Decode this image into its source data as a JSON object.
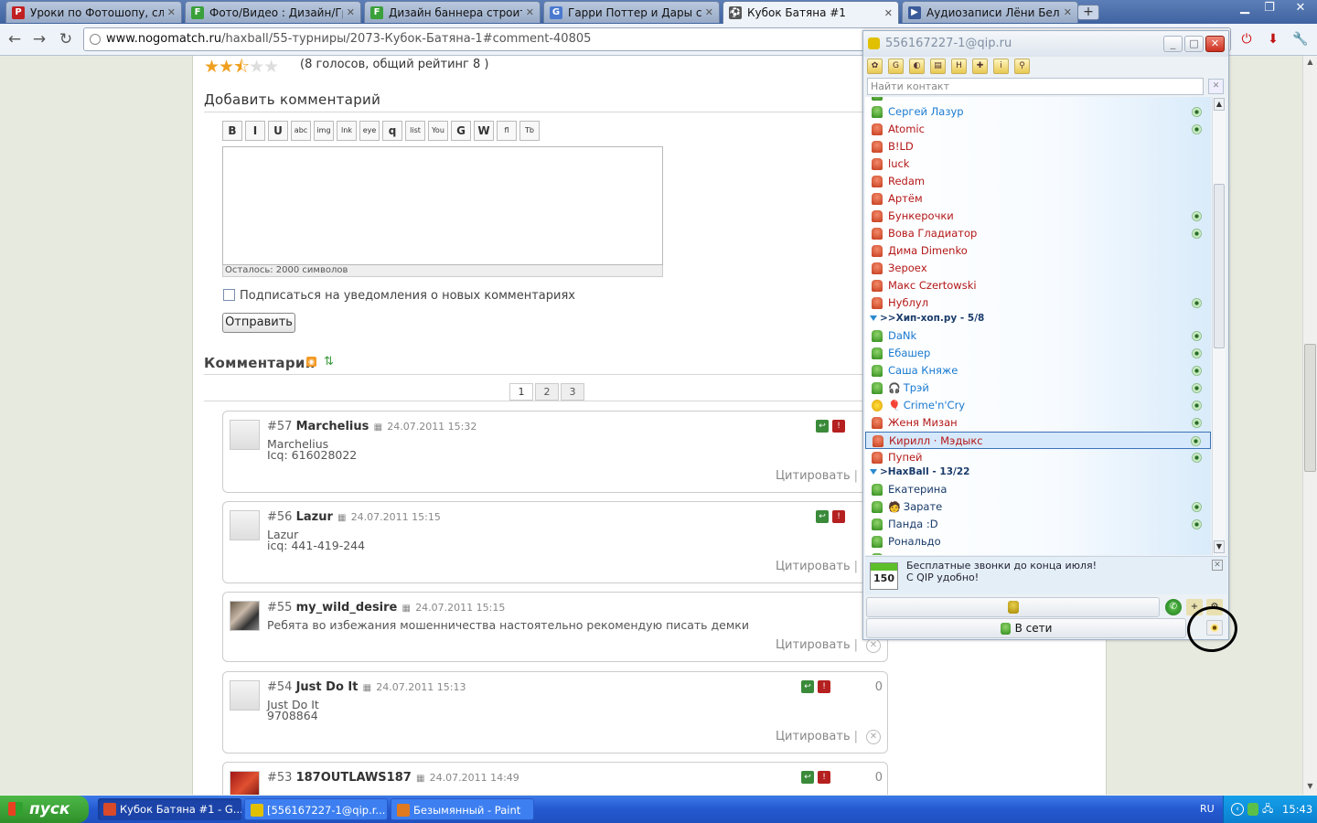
{
  "browser": {
    "tabs": [
      {
        "title": "Уроки по Фотошопу, сложнс",
        "icon_color": "#c02020",
        "icon": "P"
      },
      {
        "title": "Фото/Видео : Дизайн/Графи",
        "icon_color": "#3aa03a",
        "icon": "F"
      },
      {
        "title": "Дизайн баннера строительн",
        "icon_color": "#3aa03a",
        "icon": "F"
      },
      {
        "title": "Гарри Поттер и Дары смерт",
        "icon_color": "#4a7ad0",
        "icon": "G"
      },
      {
        "title": "Кубок Батяна #1",
        "icon_color": "#555555",
        "icon": "⚽"
      },
      {
        "title": "Аудиозаписи Лёни Белова |",
        "icon_color": "#3a5a9a",
        "icon": "▶"
      }
    ],
    "new_tab": "+",
    "url_host": "www.nogomatch.ru",
    "url_path": "/haxball/55-турниры/2073-Кубок-Батяна-1#comment-40805"
  },
  "page": {
    "rating_text": "(8 голосов, общий рейтинг 8 )",
    "add_comment_title": "Добавить комментарий",
    "editor_buttons": [
      "B",
      "I",
      "U",
      "abc",
      "img",
      "lnk",
      "eye",
      "q",
      "list",
      "You",
      "G",
      "W",
      "fl",
      "Tb"
    ],
    "chars_left": "Осталось: 2000 символов",
    "subscribe_label": "Подписаться на уведомления о новых комментариях",
    "submit_label": "Отправить",
    "comments_title": "Комментарии",
    "pages": [
      "1",
      "2",
      "3"
    ],
    "quote_label": "Цитировать",
    "comments": [
      {
        "num": "#57",
        "nick": "Marchelius",
        "date": "24.07.2011 15:32",
        "body": "Marchelius\nIcq: 616028022",
        "score": ""
      },
      {
        "num": "#56",
        "nick": "Lazur",
        "date": "24.07.2011 15:15",
        "body": "Lazur\nicq: 441-419-244",
        "score": ""
      },
      {
        "num": "#55",
        "nick": "my_wild_desire",
        "date": "24.07.2011 15:15",
        "body": "Ребята во избежания мошенничества настоятельно рекомендую писать демки",
        "score": ""
      },
      {
        "num": "#54",
        "nick": "Just Do It",
        "date": "24.07.2011 15:13",
        "body": "Just Do It\n9708864",
        "score": "0"
      },
      {
        "num": "#53",
        "nick": "187OUTLAWS187",
        "date": "24.07.2011 14:49",
        "body": "",
        "score": "0"
      }
    ]
  },
  "qip": {
    "title": "556167227-1@qip.ru",
    "search_placeholder": "Найти контакт",
    "contacts_top": [
      {
        "name": "Сергей Лазур",
        "status": "green",
        "style": "on",
        "eye": true
      },
      {
        "name": "Atomic",
        "status": "red",
        "style": "",
        "eye": true
      },
      {
        "name": "B!LD",
        "status": "red",
        "style": "",
        "eye": false
      },
      {
        "name": "luck",
        "status": "red",
        "style": "",
        "eye": false
      },
      {
        "name": "Redam",
        "status": "red",
        "style": "",
        "eye": false
      },
      {
        "name": "Артём",
        "status": "red",
        "style": "",
        "eye": false
      },
      {
        "name": "Бункерочки",
        "status": "red",
        "style": "",
        "eye": true
      },
      {
        "name": "Вова Гладиатор",
        "status": "red",
        "style": "",
        "eye": true
      },
      {
        "name": "Дима Dimenko",
        "status": "red",
        "style": "",
        "eye": false
      },
      {
        "name": "Зероех",
        "status": "red",
        "style": "",
        "eye": false
      },
      {
        "name": "Макс Czertowski",
        "status": "red",
        "style": "",
        "eye": false
      },
      {
        "name": "Нублул",
        "status": "red",
        "style": "",
        "eye": true
      }
    ],
    "group1": ">>Хип-хоп.ру - 5/8",
    "contacts_mid": [
      {
        "name": "DaNk",
        "status": "green",
        "style": "on",
        "eye": true
      },
      {
        "name": "Ебашер",
        "status": "green",
        "style": "on",
        "eye": true
      },
      {
        "name": "Саша Княже",
        "status": "green",
        "style": "on",
        "eye": true
      },
      {
        "name": "Трэй",
        "status": "green",
        "style": "on",
        "eye": true,
        "extra": "🎧"
      },
      {
        "name": "Crime'n'Cry",
        "status": "smile",
        "style": "on",
        "eye": true,
        "extra": "🎈"
      },
      {
        "name": "Женя Мизан",
        "status": "red",
        "style": "",
        "eye": true
      },
      {
        "name": "Кирилл · Мэдыкс",
        "status": "red",
        "style": "sel",
        "eye": true
      },
      {
        "name": "Пупей",
        "status": "red",
        "style": "",
        "eye": true
      }
    ],
    "group2": ">HaxBall - 13/22",
    "contacts_bot": [
      {
        "name": "Екатерина",
        "status": "green",
        "style": "on2",
        "eye": false
      },
      {
        "name": "Зарате",
        "status": "green",
        "style": "on2",
        "eye": true,
        "extra": "🧑"
      },
      {
        "name": "Панда :D",
        "status": "green",
        "style": "on2",
        "eye": true
      },
      {
        "name": "Рональдо",
        "status": "green",
        "style": "on2",
        "eye": false
      }
    ],
    "news_line1": "Бесплатные звонки до конца июля!",
    "news_line2": "С QIP удобно!",
    "news_badge": "150",
    "status_label": "В сети"
  },
  "taskbar": {
    "start": "пуск",
    "tasks": [
      {
        "title": "Кубок Батяна #1 - G...",
        "icon_color": "#d84a2a"
      },
      {
        "title": "[556167227-1@qip.r...",
        "icon_color": "#e0c000"
      },
      {
        "title": "Безымянный - Paint",
        "icon_color": "#e07a20"
      }
    ],
    "lang": "RU",
    "clock": "15:43"
  },
  "colors": {
    "accent": "#3f63a0",
    "online": "#2f8a1a",
    "offline": "#b41818"
  }
}
